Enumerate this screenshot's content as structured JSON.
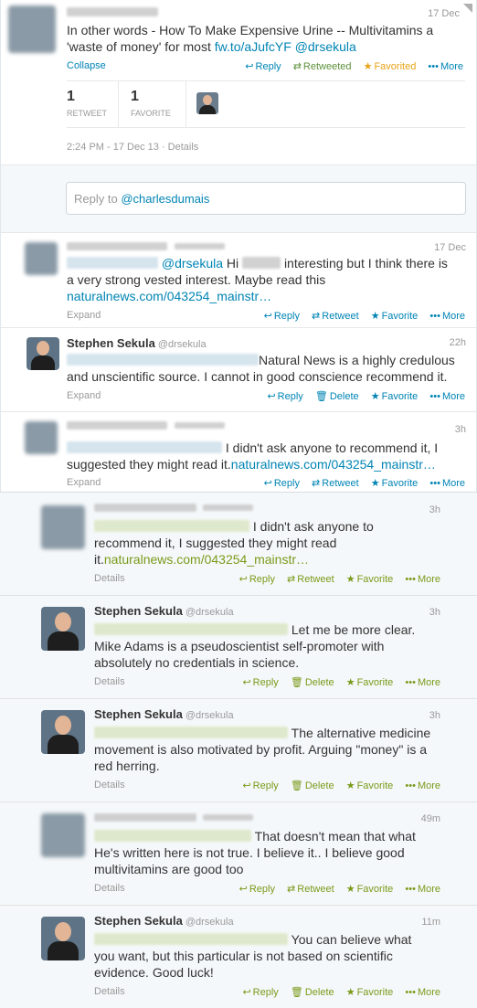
{
  "main_tweet": {
    "time": "17 Dec",
    "text_plain": "In other words - How To Make Expensive Urine -- Multivitamins a 'waste of money' for most ",
    "link": "fw.to/aJufcYF",
    "mention": "@drsekula",
    "collapse": "Collapse",
    "reply": "Reply",
    "retweeted": "Retweeted",
    "favorited": "Favorited",
    "more": "More",
    "retweet_count": "1",
    "retweet_label": "RETWEET",
    "favorite_count": "1",
    "favorite_label": "FAVORITE",
    "timestamp": "2:24 PM - 17 Dec 13",
    "details": "Details"
  },
  "reply_box": {
    "placeholder_prefix": "Reply to ",
    "placeholder_handle": "@charlesdumais"
  },
  "thread_top": [
    {
      "time": "17 Dec",
      "mention": "@drsekula",
      "hi": "Hi",
      "text": "interesting but I think there is",
      "text2": "a very strong vested interest. Maybe read this",
      "link": "naturalnews.com/043254_mainstr…",
      "expand": "Expand",
      "reply": "Reply",
      "retweet": "Retweet",
      "favorite": "Favorite",
      "more": "More"
    },
    {
      "name": "Stephen Sekula",
      "handle": "@drsekula",
      "time": "22h",
      "text": "Natural News is a highly credulous",
      "text2": "and unscientific source. I cannot in good conscience recommend it.",
      "expand": "Expand",
      "reply": "Reply",
      "delete": "Delete",
      "favorite": "Favorite",
      "more": "More"
    },
    {
      "time": "3h",
      "text": "I didn't ask anyone to recommend it, I",
      "text2": "suggested they might read it.",
      "link": "naturalnews.com/043254_mainstr…",
      "expand": "Expand",
      "reply": "Reply",
      "retweet": "Retweet",
      "favorite": "Favorite",
      "more": "More"
    }
  ],
  "thread_bottom": [
    {
      "time": "3h",
      "l1": "I didn't ask anyone to",
      "l2": "recommend it, I suggested they might read",
      "l3": "it.",
      "link": "naturalnews.com/043254_mainstr…",
      "details": "Details",
      "reply": "Reply",
      "retweet": "Retweet",
      "favorite": "Favorite",
      "more": "More"
    },
    {
      "name": "Stephen Sekula",
      "handle": "@drsekula",
      "time": "3h",
      "l1": "Let me be more clear.",
      "l2": "Mike Adams is a pseudoscientist self-promoter with",
      "l3": "absolutely no credentials in science.",
      "details": "Details",
      "reply": "Reply",
      "delete": "Delete",
      "favorite": "Favorite",
      "more": "More"
    },
    {
      "name": "Stephen Sekula",
      "handle": "@drsekula",
      "time": "3h",
      "l1": "The alternative medicine",
      "l2": "movement is also motivated by profit. Arguing \"money\" is a",
      "l3": "red herring.",
      "details": "Details",
      "reply": "Reply",
      "delete": "Delete",
      "favorite": "Favorite",
      "more": "More"
    },
    {
      "time": "49m",
      "l1": "That doesn't mean that what",
      "l2": "He's written here is not true. I believe it.. I believe good",
      "l3": "multivitamins are good too",
      "details": "Details",
      "reply": "Reply",
      "retweet": "Retweet",
      "favorite": "Favorite",
      "more": "More"
    },
    {
      "name": "Stephen Sekula",
      "handle": "@drsekula",
      "time": "11m",
      "l1": "You can believe what",
      "l2": "you want, but this particular is not based on scientific",
      "l3": "evidence. Good luck!",
      "details": "Details",
      "reply": "Reply",
      "delete": "Delete",
      "favorite": "Favorite",
      "more": "More"
    }
  ],
  "colors": {
    "link": "#0084b4",
    "link_green": "#7a9a1a",
    "favorited": "#e8a317",
    "retweeted": "#5c913b"
  },
  "icons": {
    "reply": "reply-arrow-icon",
    "retweet": "retweet-icon",
    "favorite": "star-icon",
    "delete": "trash-icon",
    "more": "dots-icon"
  }
}
